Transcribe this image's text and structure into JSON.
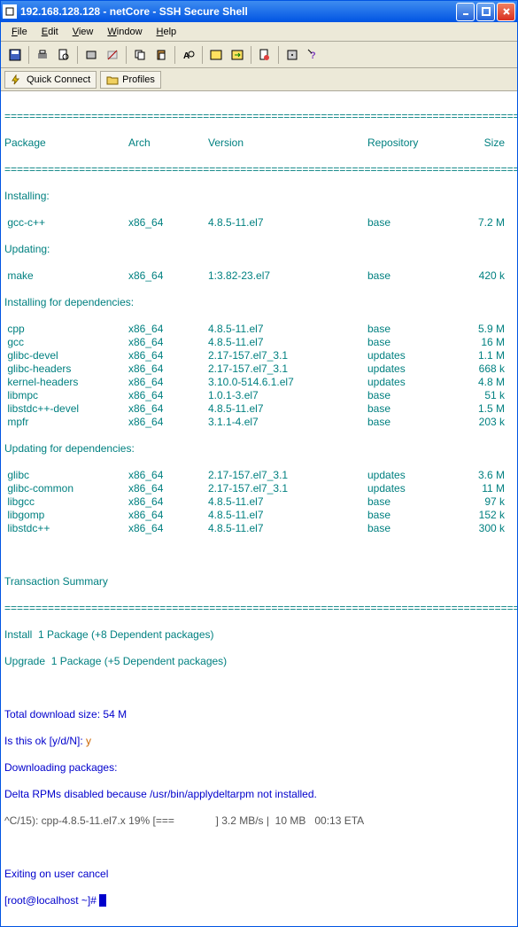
{
  "window": {
    "title": "192.168.128.128 - netCore - SSH Secure Shell"
  },
  "menu": [
    "File",
    "Edit",
    "View",
    "Window",
    "Help"
  ],
  "quick": {
    "connect": "Quick Connect",
    "profiles": "Profiles"
  },
  "hdr": {
    "pkg": "Package",
    "arch": "Arch",
    "ver": "Version",
    "repo": "Repository",
    "size": "Size"
  },
  "sec": {
    "installing": "Installing:",
    "updating": "Updating:",
    "instdep": "Installing for dependencies:",
    "upddep": "Updating for dependencies:",
    "tsum": "Transaction Summary"
  },
  "rows": {
    "inst": [
      {
        "n": "gcc-c++",
        "a": "x86_64",
        "v": "4.8.5-11.el7",
        "r": "base",
        "s": "7.2 M"
      }
    ],
    "upd": [
      {
        "n": "make",
        "a": "x86_64",
        "v": "1:3.82-23.el7",
        "r": "base",
        "s": "420 k"
      }
    ],
    "instdep": [
      {
        "n": "cpp",
        "a": "x86_64",
        "v": "4.8.5-11.el7",
        "r": "base",
        "s": "5.9 M"
      },
      {
        "n": "gcc",
        "a": "x86_64",
        "v": "4.8.5-11.el7",
        "r": "base",
        "s": "16 M"
      },
      {
        "n": "glibc-devel",
        "a": "x86_64",
        "v": "2.17-157.el7_3.1",
        "r": "updates",
        "s": "1.1 M"
      },
      {
        "n": "glibc-headers",
        "a": "x86_64",
        "v": "2.17-157.el7_3.1",
        "r": "updates",
        "s": "668 k"
      },
      {
        "n": "kernel-headers",
        "a": "x86_64",
        "v": "3.10.0-514.6.1.el7",
        "r": "updates",
        "s": "4.8 M"
      },
      {
        "n": "libmpc",
        "a": "x86_64",
        "v": "1.0.1-3.el7",
        "r": "base",
        "s": "51 k"
      },
      {
        "n": "libstdc++-devel",
        "a": "x86_64",
        "v": "4.8.5-11.el7",
        "r": "base",
        "s": "1.5 M"
      },
      {
        "n": "mpfr",
        "a": "x86_64",
        "v": "3.1.1-4.el7",
        "r": "base",
        "s": "203 k"
      }
    ],
    "upddep": [
      {
        "n": "glibc",
        "a": "x86_64",
        "v": "2.17-157.el7_3.1",
        "r": "updates",
        "s": "3.6 M"
      },
      {
        "n": "glibc-common",
        "a": "x86_64",
        "v": "2.17-157.el7_3.1",
        "r": "updates",
        "s": "11 M"
      },
      {
        "n": "libgcc",
        "a": "x86_64",
        "v": "4.8.5-11.el7",
        "r": "base",
        "s": "97 k"
      },
      {
        "n": "libgomp",
        "a": "x86_64",
        "v": "4.8.5-11.el7",
        "r": "base",
        "s": "152 k"
      },
      {
        "n": "libstdc++",
        "a": "x86_64",
        "v": "4.8.5-11.el7",
        "r": "base",
        "s": "300 k"
      }
    ]
  },
  "summary": {
    "install": "Install  1 Package (+8 Dependent packages)",
    "upgrade": "Upgrade  1 Package (+5 Dependent packages)",
    "total": "Total download size: 54 M",
    "okprompt": "Is this ok [y/d/N]:",
    "okans": "y",
    "downloading": "Downloading packages:",
    "delta": "Delta RPMs disabled because /usr/bin/applydeltarpm not installed.",
    "progress": "^C/15): cpp-4.8.5-11.el7.x 19% [===              ] 3.2 MB/s |  10 MB   00:13 ETA",
    "exit": "Exiting on user cancel",
    "prompt_user": "[root@localhost ~]# "
  },
  "hr": "==================================================================================="
}
